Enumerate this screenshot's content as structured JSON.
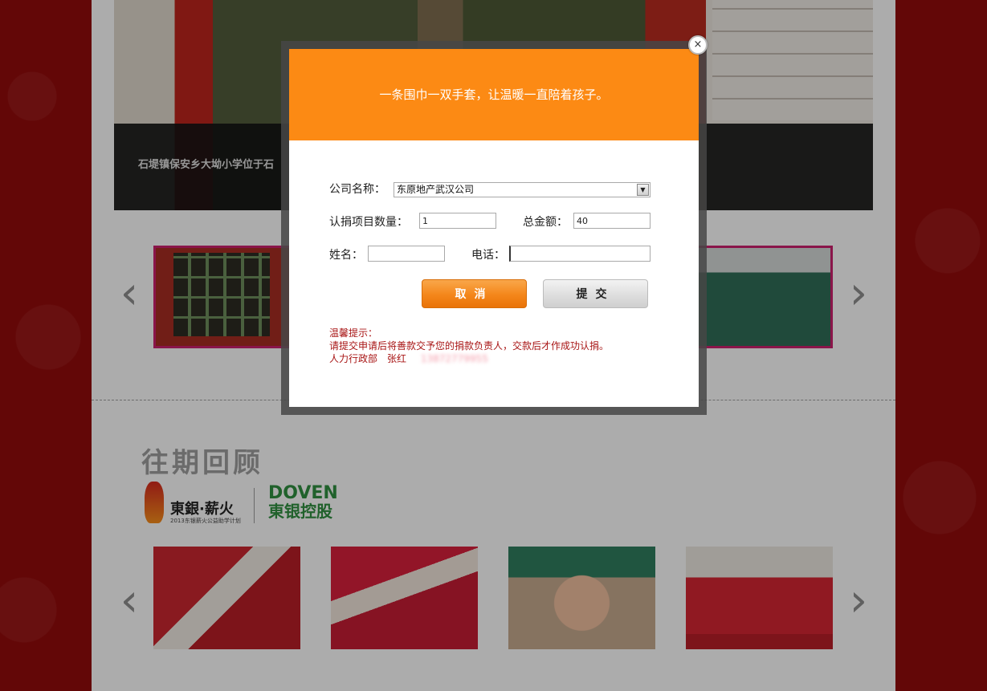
{
  "hero": {
    "caption": "石堤镇保安乡大坳小学位于石"
  },
  "carousel": {
    "prev_glyph": "‹",
    "next_glyph": "›"
  },
  "review": {
    "title": "往期回顾",
    "logo_left": "東銀·薪火",
    "logo_left_sub": "2013东银薪火公益助学计划",
    "logo_right_en": "DOVEN",
    "logo_right_cn": "東银控股"
  },
  "modal": {
    "header": "一条围巾一双手套，让温暖一直陪着孩子。",
    "close_glyph": "×",
    "company_label": "公司名称：",
    "company_value": "东原地产武汉公司",
    "dropdown_glyph": "▼",
    "quantity_label": "认捐项目数量：",
    "quantity_value": "1",
    "total_label": "总金额：",
    "total_value": "40",
    "name_label": "姓名：",
    "name_value": "",
    "phone_label": "电话：",
    "phone_value": "",
    "cancel_label": "取消",
    "submit_label": "提交",
    "tip_title": "温馨提示：",
    "tip_body": "请提交申请后将善款交予您的捐款负责人，交款后才作成功认捐。",
    "tip_contact": "人力行政部　张红",
    "tip_phone": "13872779955"
  },
  "colors": {
    "accent_orange": "#fc8a14",
    "tip_red": "#a81515",
    "thumb_border": "#c61f6a"
  }
}
